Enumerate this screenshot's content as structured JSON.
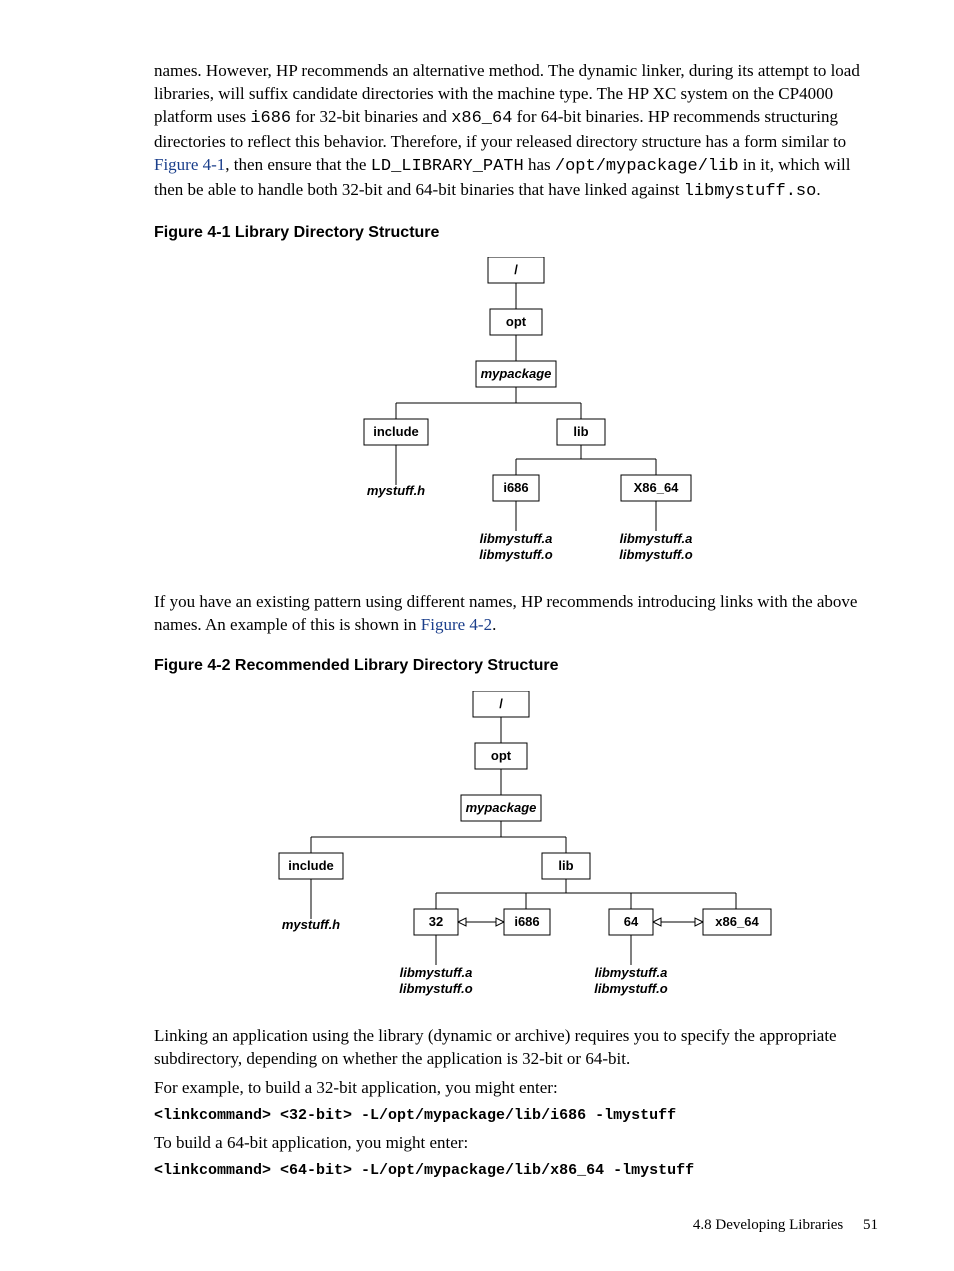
{
  "para1": {
    "t1": "names. However, HP recommends an alternative method. The dynamic linker, during its attempt to load libraries, will suffix candidate directories with the machine type. The HP XC system on the CP4000 platform uses ",
    "m1": "i686",
    "t2": " for 32-bit binaries and ",
    "m2": "x86_64",
    "t3": " for 64-bit binaries. HP recommends structuring directories to reflect this behavior. Therefore, if your released directory structure has a form similar to ",
    "link1": "Figure 4-1",
    "t4": ", then ensure that the ",
    "m3": "LD_LIBRARY_PATH",
    "t5": " has ",
    "m4": "/opt/mypackage/lib",
    "t6": " in it, which will then be able to handle both 32-bit and 64-bit binaries that have linked against ",
    "m5": "libmystuff.so",
    "t7": "."
  },
  "fig1_title": "Figure  4-1  Library Directory Structure",
  "fig2_title": "Figure  4-2  Recommended Library Directory Structure",
  "diagram": {
    "root": "/",
    "opt": "opt",
    "mypackage": "mypackage",
    "include": "include",
    "mystuff_h": "mystuff.h",
    "lib": "lib",
    "i686": "i686",
    "x86_64_cap": "X86_64",
    "x86_64_low": "x86_64",
    "d32": "32",
    "d64": "64",
    "libmystuff_a": "libmystuff.a",
    "libmystuff_o": "libmystuff.o"
  },
  "para2": {
    "t1": "If you have an existing pattern using different names, HP recommends introducing links with the above names. An example of this is shown in ",
    "link1": "Figure 4-2",
    "t2": "."
  },
  "para3": "Linking an application using the library (dynamic or archive) requires you to specify the appropriate subdirectory, depending on whether the application is 32-bit or 64-bit.",
  "para4": "For example, to build a 32-bit application, you might enter:",
  "cmd1": "<linkcommand> <32-bit> -L/opt/mypackage/lib/i686 -lmystuff",
  "para5": "To build a 64-bit application, you might enter:",
  "cmd2": "<linkcommand> <64-bit> -L/opt/mypackage/lib/x86_64 -lmystuff",
  "footer_section": "4.8 Developing Libraries",
  "footer_page": "51"
}
